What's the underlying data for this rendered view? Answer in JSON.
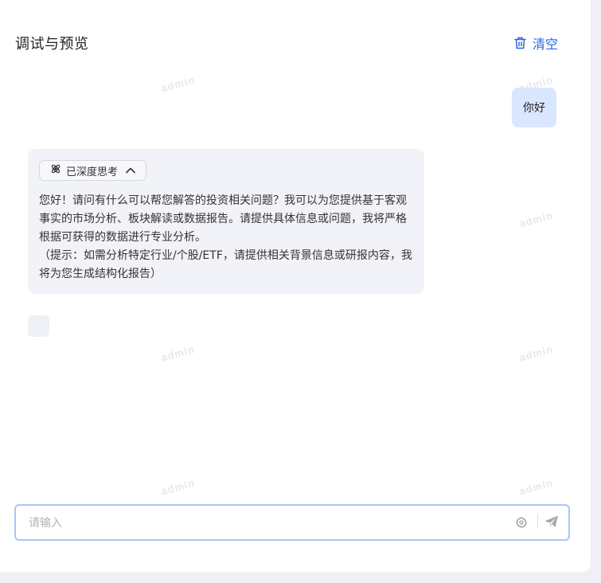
{
  "header": {
    "title": "调试与预览",
    "clear_label": "清空"
  },
  "watermark": "admin",
  "messages": {
    "user": "你好",
    "bot": {
      "think_label": "已深度思考",
      "lines": [
        "您好！请问有什么可以帮您解答的投资相关问题？我可以为您提供基于客观事实的市场分析、板块解读或数据报告。请提供具体信息或问题，我将严格根据可获得的数据进行专业分析。",
        "（提示：如需分析特定行业/个股/ETF，请提供相关背景信息或研报内容，我将为您生成结构化报告）"
      ]
    }
  },
  "input": {
    "placeholder": "请输入",
    "value": ""
  },
  "icons": {
    "clear": "trash-icon",
    "think": "atom-icon",
    "collapse": "chevron-up-icon",
    "settings": "gear-icon",
    "send": "send-icon"
  },
  "colors": {
    "accent": "#2a66e6",
    "user_bubble": "#d9e6ff",
    "bot_bubble": "#f2f3f8",
    "input_border": "#a9c7f5"
  }
}
